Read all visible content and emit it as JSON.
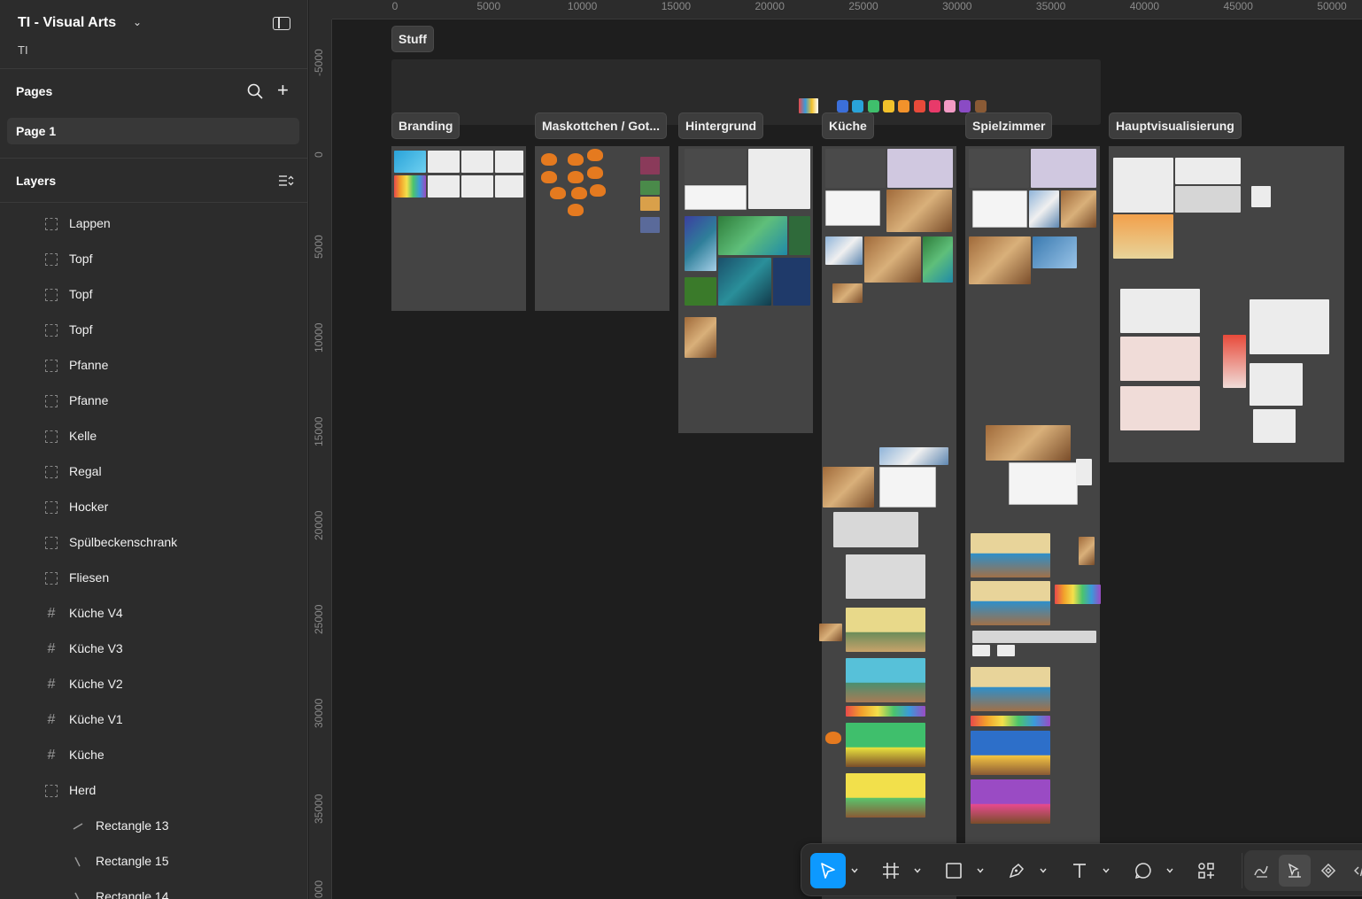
{
  "file": {
    "title": "TI - Visual Arts",
    "team": "TI"
  },
  "pages": {
    "title": "Pages",
    "items": [
      {
        "label": "Page 1"
      }
    ]
  },
  "layers": {
    "title": "Layers",
    "items": [
      {
        "label": "Lappen",
        "type": "group"
      },
      {
        "label": "Topf",
        "type": "group"
      },
      {
        "label": "Topf",
        "type": "group"
      },
      {
        "label": "Topf",
        "type": "group"
      },
      {
        "label": "Pfanne",
        "type": "group"
      },
      {
        "label": "Pfanne",
        "type": "group"
      },
      {
        "label": "Kelle",
        "type": "group"
      },
      {
        "label": "Regal",
        "type": "group"
      },
      {
        "label": "Hocker",
        "type": "group"
      },
      {
        "label": "Spülbeckenschrank",
        "type": "group"
      },
      {
        "label": "Fliesen",
        "type": "group"
      },
      {
        "label": "Küche V4",
        "type": "frame"
      },
      {
        "label": "Küche V3",
        "type": "frame"
      },
      {
        "label": "Küche V2",
        "type": "frame"
      },
      {
        "label": "Küche V1",
        "type": "frame"
      },
      {
        "label": "Küche",
        "type": "frame"
      },
      {
        "label": "Herd",
        "type": "group"
      },
      {
        "label": "Rectangle 13",
        "type": "vector"
      },
      {
        "label": "Rectangle 15",
        "type": "vector"
      },
      {
        "label": "Rectangle 14",
        "type": "vector"
      }
    ]
  },
  "ruler": {
    "x_ticks": [
      "0",
      "5000",
      "10000",
      "15000",
      "20000",
      "25000",
      "30000",
      "35000",
      "40000",
      "45000",
      "50000"
    ],
    "y_ticks": [
      "-5000",
      "0",
      "5000",
      "10000",
      "15000",
      "20000",
      "25000",
      "30000",
      "35000",
      "000"
    ]
  },
  "canvas": {
    "stuff_label": "Stuff",
    "sections": [
      {
        "label": "Branding"
      },
      {
        "label": "Maskottchen / Got..."
      },
      {
        "label": "Hintergrund"
      },
      {
        "label": "Küche"
      },
      {
        "label": "Spielzimmer"
      },
      {
        "label": "Hauptvisualisierung"
      }
    ],
    "palette": [
      "#3b6fd9",
      "#29a3d9",
      "#3fbf6c",
      "#f2c12b",
      "#f2922b",
      "#e84a3a",
      "#e83a6a",
      "#f29ac4",
      "#8a4bc4",
      "#8a5a35"
    ]
  },
  "toolbar": {
    "tools": [
      "move-tool",
      "frame-tool",
      "shape-tool",
      "pen-tool",
      "text-tool",
      "comment-tool",
      "actions-tool"
    ],
    "modes": [
      "draw-mode",
      "design-mode",
      "prototype-mode",
      "dev-mode"
    ],
    "accent": "#0d99ff"
  }
}
